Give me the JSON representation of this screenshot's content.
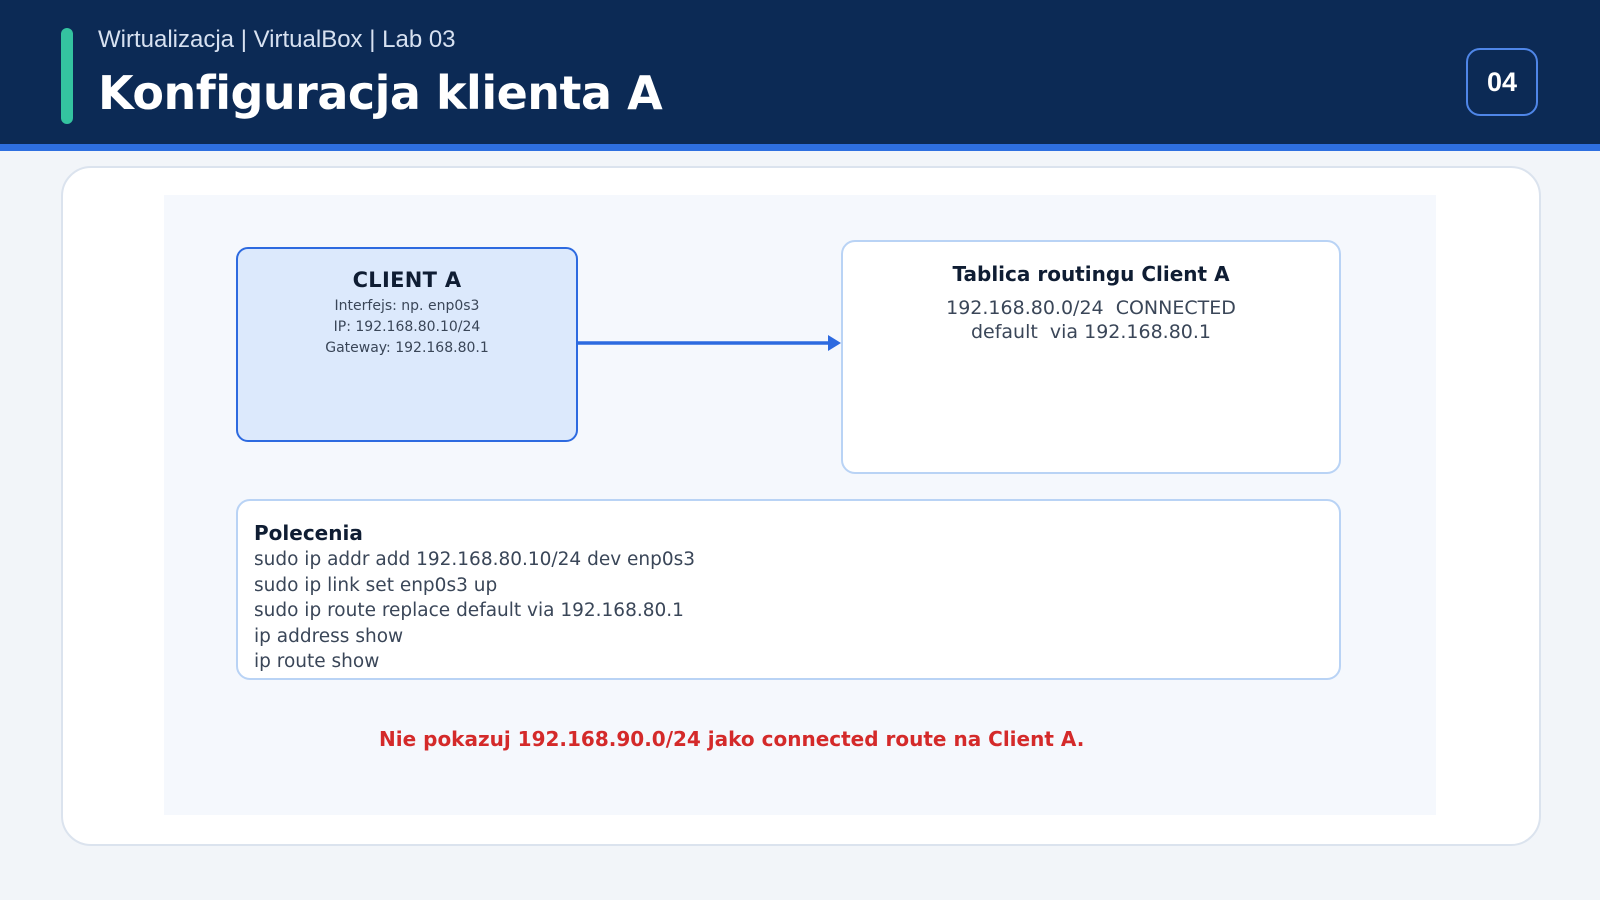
{
  "header": {
    "subtitle": "Wirtualizacja | VirtualBox | Lab 03",
    "title": "Konfiguracja klienta A",
    "page_number": "04"
  },
  "colors": {
    "header_bg": "#0c2a55",
    "accent": "#34c3a0",
    "link_blue": "#2e6fe0",
    "warning_red": "#d42a2a"
  },
  "client": {
    "title": "CLIENT A",
    "interface": "Interfejs: np. enp0s3",
    "ip": "IP: 192.168.80.10/24",
    "gateway": "Gateway: 192.168.80.1"
  },
  "routing": {
    "title": "Tablica routingu Client A",
    "rows": [
      "192.168.80.0/24  CONNECTED",
      "default  via 192.168.80.1"
    ]
  },
  "commands": {
    "title": "Polecenia",
    "lines": [
      "sudo ip addr add 192.168.80.10/24 dev enp0s3",
      "sudo ip link set enp0s3 up",
      "sudo ip route replace default via 192.168.80.1",
      "ip address show",
      "ip route show"
    ]
  },
  "warning": "Nie pokazuj 192.168.90.0/24 jako connected route na Client A."
}
